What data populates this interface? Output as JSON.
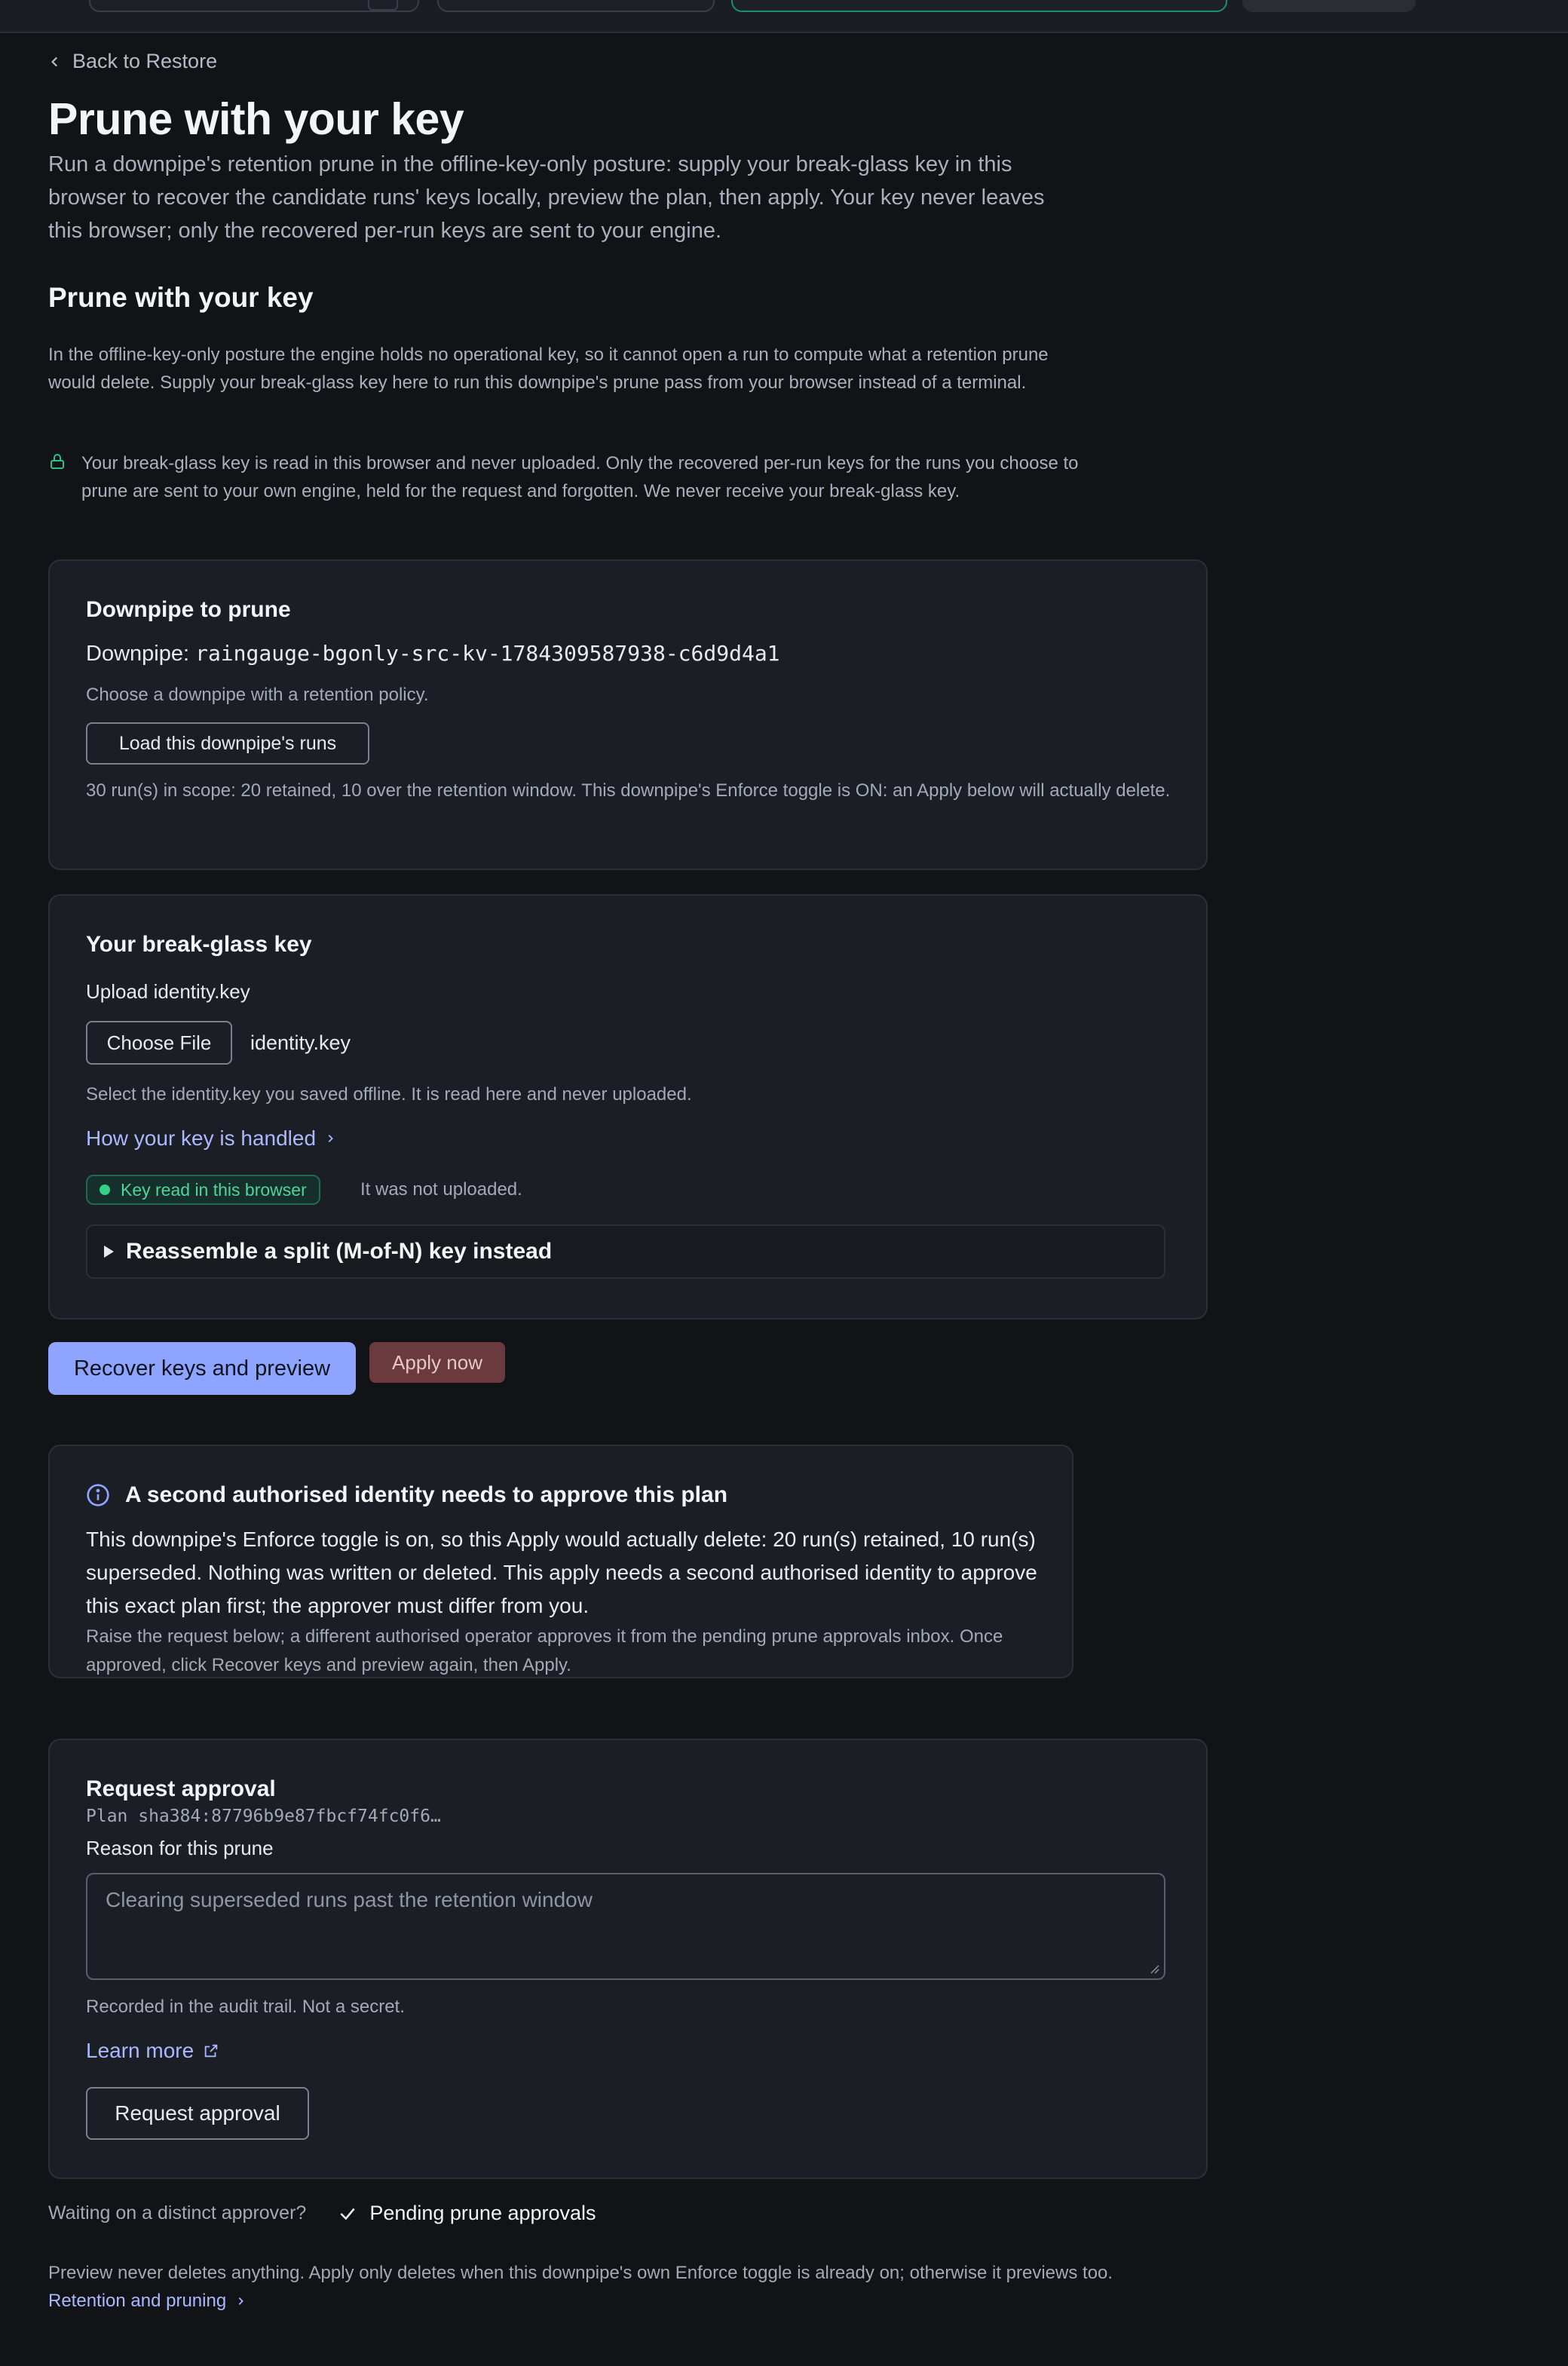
{
  "nav": {
    "back_label": "Back to Restore"
  },
  "page": {
    "title": "Prune with your key",
    "lede": "Run a downpipe's retention prune in the offline-key-only posture: supply your break-glass key in this browser to recover the candidate runs' keys locally, preview the plan, then apply. Your key never leaves this browser; only the recovered per-run keys are sent to your engine."
  },
  "section": {
    "heading": "Prune with your key",
    "description": "In the offline-key-only posture the engine holds no operational key, so it cannot open a run to compute what a retention prune would delete. Supply your break-glass key here to run this downpipe's prune pass from your browser instead of a terminal.",
    "privacy_note": "Your break-glass key is read in this browser and never uploaded. Only the recovered per-run keys for the runs you choose to prune are sent to your own engine, held for the request and forgotten. We never receive your break-glass key."
  },
  "downpipe_card": {
    "title": "Downpipe to prune",
    "label": "Downpipe:",
    "value": "raingauge-bgonly-src-kv-1784309587938-c6d9d4a1",
    "hint": "Choose a downpipe with a retention policy.",
    "load_button": "Load this downpipe's runs",
    "scope_text": "30 run(s) in scope: 20 retained, 10 over the retention window. This downpipe's Enforce toggle is ON: an Apply below will actually delete."
  },
  "key_card": {
    "title": "Your break-glass key",
    "upload_label": "Upload identity.key",
    "choose_file_button": "Choose File",
    "file_name": "identity.key",
    "hint": "Select the identity.key you saved offline. It is read here and never uploaded.",
    "how_link": "How your key is handled",
    "badge": "Key read in this browser",
    "badge_note": "It was not uploaded.",
    "split_key_summary": "Reassemble a split (M-of-N) key instead"
  },
  "actions": {
    "recover_button": "Recover keys and preview",
    "apply_button": "Apply now"
  },
  "approval_alert": {
    "title": "A second authorised identity needs to approve this plan",
    "body": "This downpipe's Enforce toggle is on, so this Apply would actually delete: 20 run(s) retained, 10 run(s) superseded. Nothing was written or deleted. This apply needs a second authorised identity to approve this exact plan first; the approver must differ from you.",
    "detail": "Raise the request below; a different authorised operator approves it from the pending prune approvals inbox. Once approved, click Recover keys and preview again, then Apply."
  },
  "request_card": {
    "title": "Request approval",
    "plan": "Plan sha384:87796b9e87fbcf74fc0f6…",
    "reason_label": "Reason for this prune",
    "reason_placeholder": "Clearing superseded runs past the retention window",
    "reason_hint": "Recorded in the audit trail. Not a secret.",
    "learn_more": "Learn more",
    "submit_button": "Request approval"
  },
  "footer": {
    "waiting_text": "Waiting on a distinct approver?",
    "pending_link": "Pending prune approvals",
    "note": "Preview never deletes anything. Apply only deletes when this downpipe's own Enforce toggle is already on; otherwise it previews too.",
    "note_link": "Retention and pruning"
  },
  "icons": [
    "chevron-left-icon",
    "lock-icon",
    "chevron-right-icon",
    "info-icon",
    "external-link-icon",
    "check-icon"
  ],
  "colors": {
    "accent": "#8ea4ff",
    "danger": "#6a3a3e",
    "success": "#33d086",
    "background": "#111317",
    "card": "#1b1e24"
  }
}
